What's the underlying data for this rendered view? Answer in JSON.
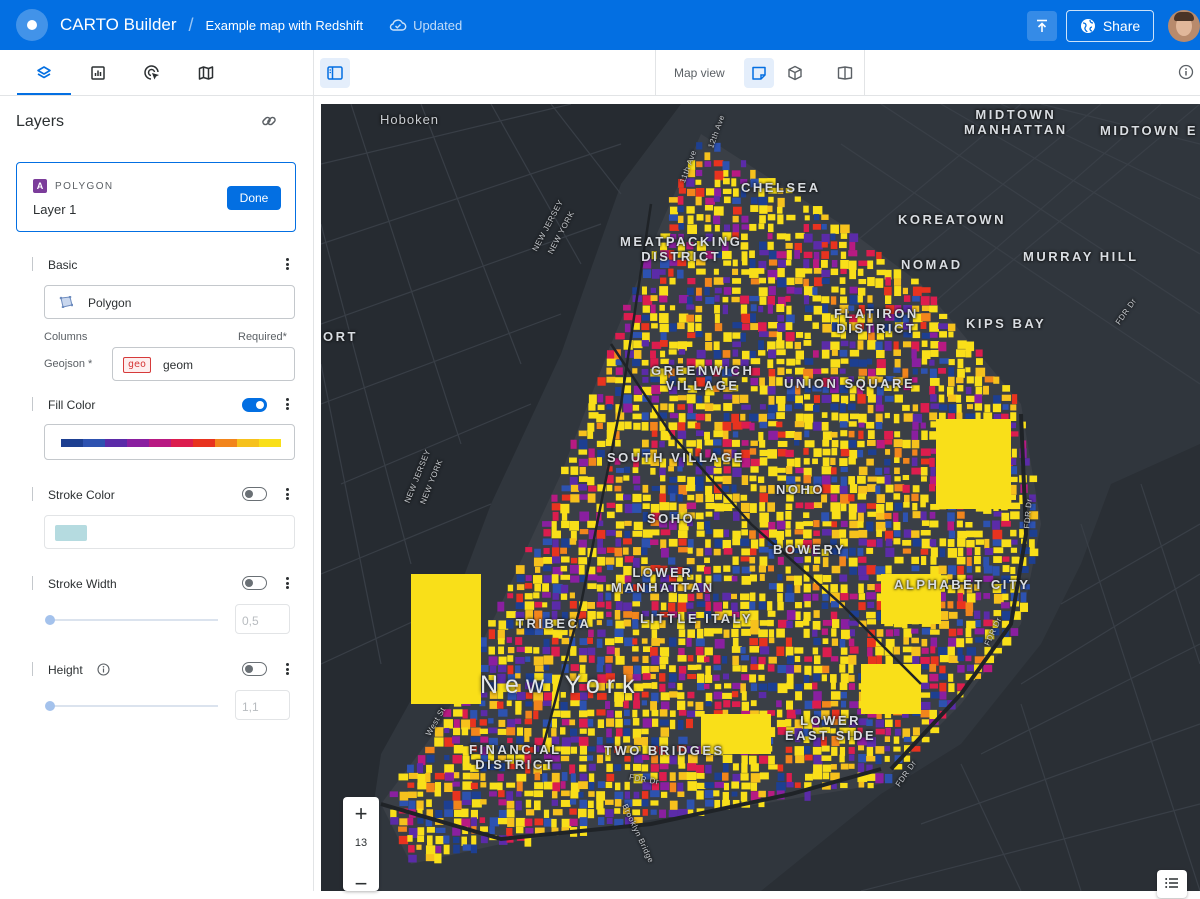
{
  "app": {
    "name": "CARTO Builder",
    "map_title": "Example map with Redshift",
    "status": "Updated",
    "share_label": "Share"
  },
  "side_tabs": [
    "layers-icon",
    "widgets-icon",
    "interactions-icon",
    "basemap-icon"
  ],
  "toolbar": {
    "view_label": "Map view"
  },
  "layers_panel": {
    "title": "Layers",
    "layer": {
      "badge": "A",
      "type": "POLYGON",
      "name": "Layer 1",
      "done_label": "Done"
    },
    "basic": {
      "label": "Basic",
      "geometry_type": "Polygon",
      "columns_label": "Columns",
      "required_label": "Required*",
      "geojson_label": "Geojson *",
      "geo_chip": "geo",
      "geo_column": "geom"
    },
    "fill_color": {
      "label": "Fill Color",
      "enabled": true,
      "ramp": [
        "#1d3f91",
        "#2d52b0",
        "#5b2ba8",
        "#8a1fa0",
        "#b81a82",
        "#dc1d4e",
        "#e8331f",
        "#f2851c",
        "#f6c11d",
        "#f9df19"
      ]
    },
    "stroke_color": {
      "label": "Stroke Color",
      "enabled": false,
      "swatch": "#b5dbe0"
    },
    "stroke_width": {
      "label": "Stroke Width",
      "enabled": false,
      "value": "0,5"
    },
    "height": {
      "label": "Height",
      "enabled": false,
      "value": "1,1"
    }
  },
  "map": {
    "zoom_level": "13",
    "zoom_in": "+",
    "zoom_out": "−",
    "labels": {
      "midtown_manhattan": "MIDTOWN\nMANHATTAN",
      "midtown_east": "MIDTOWN E",
      "hoboken": "Hoboken",
      "chelsea": "CHELSEA",
      "koreatown": "KOREATOWN",
      "nomad": "NOMAD",
      "murray_hill": "MURRAY HILL",
      "meatpacking": "MEATPACKING\nDISTRICT",
      "flatiron": "FLATIRON\nDISTRICT",
      "kips_bay": "KIPS BAY",
      "greenwich": "GREENWICH\nVILLAGE",
      "union_square": "UNION SQUARE",
      "south_village": "SOUTH VILLAGE",
      "noho": "NOHO",
      "soho": "SOHO",
      "bowery": "BOWERY",
      "lower_manhattan": "LOWER\nMANHATTAN",
      "alphabet_city": "ALPHABET CITY",
      "tribeca": "TRIBECA",
      "little_italy": "LITTLE ITALY",
      "new_york": "New York",
      "lower_east_side": "LOWER\nEAST SIDE",
      "financial_district": "FINANCIAL\nDISTRICT",
      "two_bridges": "TWO BRIDGES",
      "ort": "ORT",
      "nj_ny_1": "NEW JERSEY\nNEW YORK",
      "nj_ny_2": "NEW JERSEY\nNEW YORK",
      "fdr_1": "FDR Dr",
      "fdr_2": "FDR Dr",
      "fdr_3": "FDR Dr",
      "fdr_4": "FDR Dr",
      "fdr_5": "FDR Dr",
      "eleventh_ave": "11th Ave",
      "twelfth_ave": "12th Ave",
      "brooklyn_bridge": "Brooklyn Bridge",
      "west_st": "West St"
    }
  }
}
